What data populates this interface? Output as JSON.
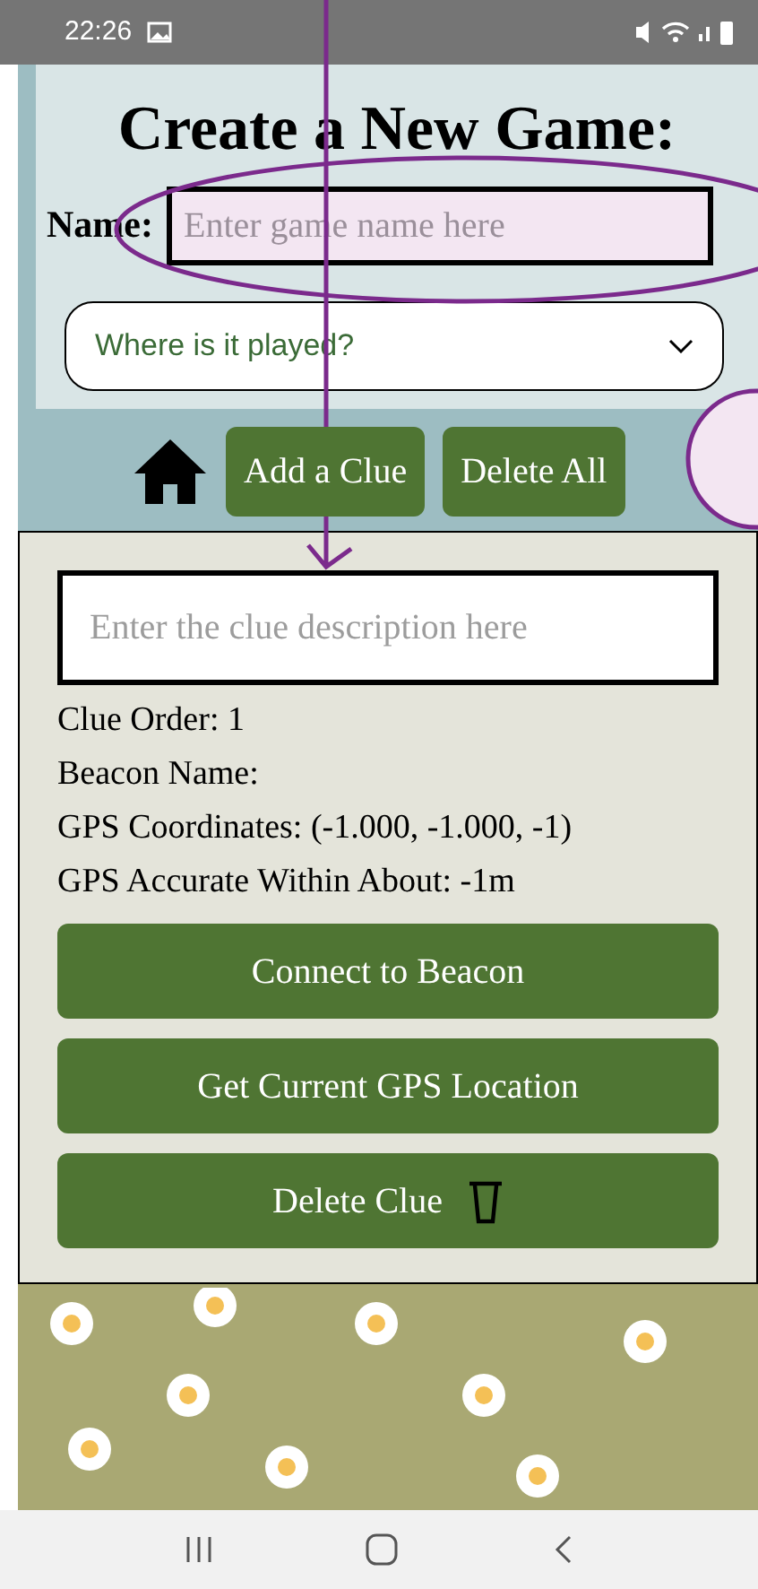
{
  "status_bar": {
    "time": "22:26"
  },
  "header": {
    "title": "Create a New Game:",
    "name_label": "Name:",
    "name_field": {
      "placeholder": "Enter game name here"
    },
    "location_dropdown": {
      "placeholder": "Where is it played?"
    }
  },
  "toolbar": {
    "buttons": [
      "Add a Clue",
      "Delete All"
    ]
  },
  "clue": {
    "description_field": {
      "placeholder": "Enter the clue description here"
    },
    "details": [
      "Clue Order: 1",
      "Beacon Name:",
      "GPS Coordinates: (-1.000, -1.000, -1)",
      "GPS Accurate Within About: -1m"
    ],
    "buttons": [
      {
        "label": "Connect to Beacon",
        "kind": "plain"
      },
      {
        "label": "Get Current GPS Location",
        "kind": "plain"
      },
      {
        "label": "Delete Clue",
        "kind": "delete"
      }
    ]
  }
}
